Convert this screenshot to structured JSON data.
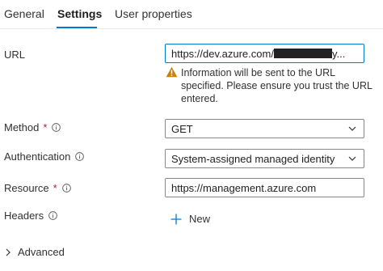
{
  "tabs": [
    {
      "label": "General"
    },
    {
      "label": "Settings"
    },
    {
      "label": "User properties"
    }
  ],
  "form": {
    "url": {
      "label": "URL",
      "value_visible": "https://dev.azure.com/",
      "value_suffix": "y..."
    },
    "warning": {
      "text": "Information will be sent to the URL specified. Please ensure you trust the URL entered."
    },
    "method": {
      "label": "Method",
      "required_mark": "*",
      "value": "GET"
    },
    "authentication": {
      "label": "Authentication",
      "value": "System-assigned managed identity"
    },
    "resource": {
      "label": "Resource",
      "required_mark": "*",
      "value": "https://management.azure.com"
    },
    "headers": {
      "label": "Headers",
      "new_label": "New"
    }
  },
  "advanced": {
    "label": "Advanced"
  },
  "colors": {
    "accent": "#0078d4",
    "warning": "#d08000",
    "required": "#a4262c"
  },
  "icons": {
    "info": "info-circle-icon",
    "warning": "warning-triangle-icon",
    "dropdown": "chevron-down-icon",
    "add": "plus-icon",
    "expand": "chevron-right-icon"
  }
}
